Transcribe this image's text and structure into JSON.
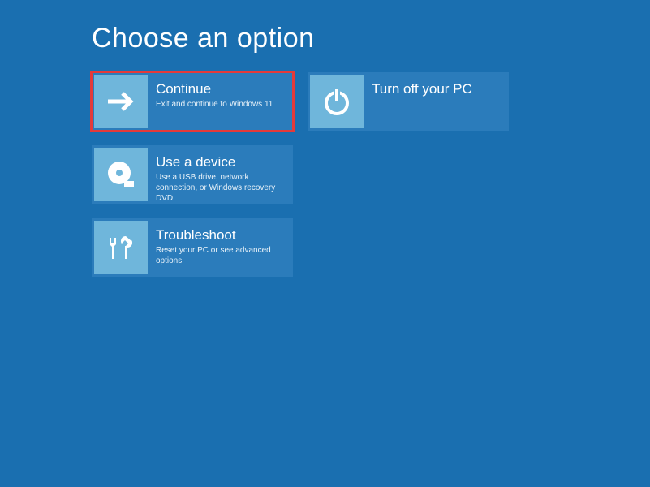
{
  "title": "Choose an option",
  "options": {
    "continue": {
      "title": "Continue",
      "desc": "Exit and continue to Windows 11"
    },
    "useDevice": {
      "title": "Use a device",
      "desc": "Use a USB drive, network connection, or Windows recovery DVD"
    },
    "troubleshoot": {
      "title": "Troubleshoot",
      "desc": "Reset your PC or see advanced options"
    },
    "turnOff": {
      "title": "Turn off your PC",
      "desc": ""
    }
  }
}
